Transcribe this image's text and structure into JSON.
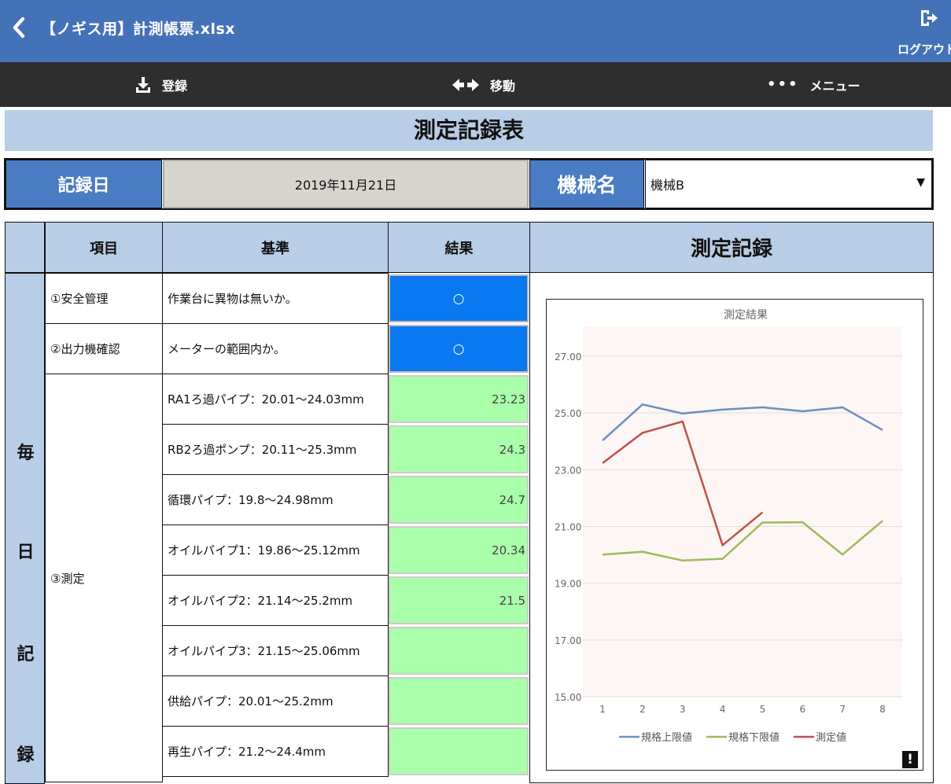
{
  "app": {
    "file_title": "【ノギス用】計測帳票.xlsx",
    "logout_label": "ログアウト"
  },
  "toolbar": {
    "register_label": "登録",
    "move_label": "移動",
    "menu_label": "メニュー"
  },
  "sheet": {
    "title": "測定記録表",
    "record_date_label": "記録日",
    "record_date_value": "2019年11月21日",
    "machine_label": "機械名",
    "machine_value": "機械B"
  },
  "table": {
    "headers": {
      "item": "項目",
      "standard": "基準",
      "result": "結果",
      "chart": "測定記録"
    },
    "side_label": [
      "毎",
      "日",
      "記",
      "録"
    ],
    "rows": [
      {
        "item": "①安全管理",
        "standard": "作業台に異物は無いか。",
        "result": "○",
        "kind": "check"
      },
      {
        "item": "②出力機確認",
        "standard": "メーターの範囲内か。",
        "result": "○",
        "kind": "check"
      }
    ],
    "measure_item": "③測定",
    "measure_rows": [
      {
        "standard": "RA1ろ過パイプ：20.01～24.03mm",
        "result": "23.23"
      },
      {
        "standard": "RB2ろ過ポンプ：20.11～25.3mm",
        "result": "24.3"
      },
      {
        "standard": "循環パイプ：19.8～24.98mm",
        "result": "24.7"
      },
      {
        "standard": "オイルパイプ1：19.86～25.12mm",
        "result": "20.34"
      },
      {
        "standard": "オイルパイプ2：21.14～25.2mm",
        "result": "21.5"
      },
      {
        "standard": "オイルパイプ3：21.15～25.06mm",
        "result": ""
      },
      {
        "standard": "供給パイプ：20.01～25.2mm",
        "result": ""
      },
      {
        "standard": "再生パイプ：21.2～24.4mm",
        "result": ""
      }
    ]
  },
  "colors": {
    "header_blue": "#4a7cc4",
    "header_light": "#b8cde6",
    "result_blue": "#0a78f0",
    "result_green": "#aaffaa",
    "titlebar": "#4472b8"
  },
  "chart_data": {
    "type": "line",
    "title": "測定結果",
    "x": [
      1,
      2,
      3,
      4,
      5,
      6,
      7,
      8
    ],
    "ylim": [
      15,
      27
    ],
    "yticks": [
      "15.00",
      "17.00",
      "19.00",
      "21.00",
      "23.00",
      "25.00",
      "27.00"
    ],
    "grid": true,
    "legend": "bottom",
    "series": [
      {
        "name": "規格上限値",
        "color": "#6a8fc6",
        "values": [
          24.03,
          25.3,
          24.98,
          25.12,
          25.2,
          25.06,
          25.2,
          24.4
        ]
      },
      {
        "name": "規格下限値",
        "color": "#9bbb59",
        "values": [
          20.01,
          20.11,
          19.8,
          19.86,
          21.14,
          21.15,
          20.01,
          21.2
        ]
      },
      {
        "name": "測定値",
        "color": "#c0504d",
        "values": [
          23.23,
          24.3,
          24.7,
          20.34,
          21.5
        ]
      }
    ]
  }
}
